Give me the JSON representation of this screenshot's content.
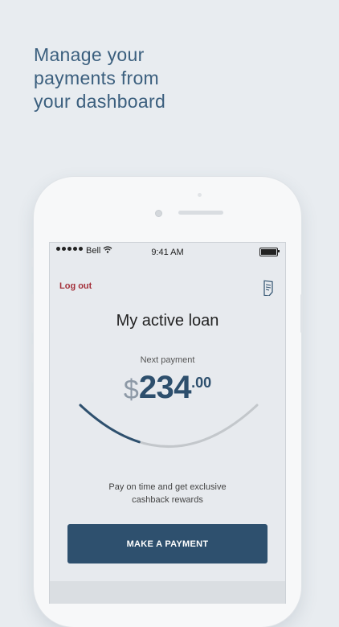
{
  "headline": {
    "lines": [
      "Manage your",
      "payments from",
      "your dashboard"
    ]
  },
  "status_bar": {
    "carrier": "Bell",
    "time": "9:41 AM"
  },
  "header": {
    "logout_label": "Log out",
    "doc_icon": "document-icon"
  },
  "loan": {
    "title": "My active loan",
    "next_payment_label": "Next payment",
    "currency": "$",
    "amount_whole": "234",
    "amount_cents": ".00",
    "progress_fraction": 0.35
  },
  "promo": {
    "lines": [
      "Pay on time and get exclusive",
      "cashback rewards"
    ]
  },
  "actions": {
    "make_payment_label": "MAKE A PAYMENT"
  },
  "colors": {
    "accent": "#2e506e",
    "logout": "#a3303a",
    "headline": "#3b5f7e",
    "background": "#e8ecf0"
  }
}
